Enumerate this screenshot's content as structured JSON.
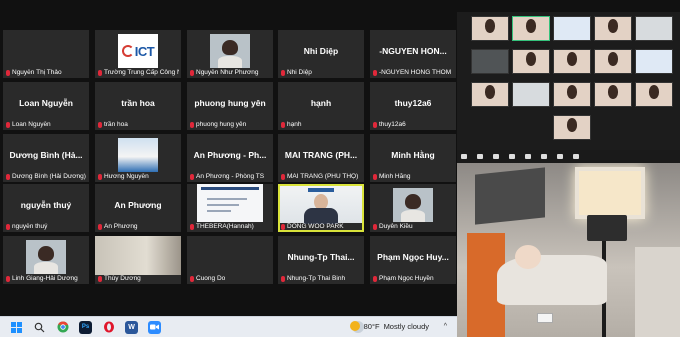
{
  "gallery": {
    "rows": [
      [
        {
          "name": "Nguyễn Thị Thảo",
          "center": "",
          "video": "none"
        },
        {
          "name": "Trường Trung Cấp Công N...",
          "center": "",
          "video": "ict"
        },
        {
          "name": "Nguyễn Như Phương",
          "center": "",
          "video": "person"
        },
        {
          "name": "Nhi Diệp",
          "center": "Nhi Diệp",
          "video": "none"
        },
        {
          "name": "-NGUYEN HONG THOM",
          "center": "-NGUYEN HON...",
          "video": "none"
        }
      ],
      [
        {
          "name": "Loan Nguyễn",
          "center": "Loan Nguyễn",
          "video": "none"
        },
        {
          "name": "trần hoa",
          "center": "trần hoa",
          "video": "none"
        },
        {
          "name": "phuong hung yên",
          "center": "phuong hung yên",
          "video": "none"
        },
        {
          "name": "hạnh",
          "center": "hạnh",
          "video": "none"
        },
        {
          "name": "thuy12a6",
          "center": "thuy12a6",
          "video": "none"
        }
      ],
      [
        {
          "name": "Dương Bình (Hải Dương)",
          "center": "Dương Bình (Hả...",
          "video": "none"
        },
        {
          "name": "Hương Nguyễn",
          "center": "",
          "video": "group"
        },
        {
          "name": "An Phương - Phòng TS",
          "center": "An Phương - Ph...",
          "video": "none"
        },
        {
          "name": "MAI TRANG (PHÚ THỌ)",
          "center": "MAI TRANG (PH...",
          "video": "none"
        },
        {
          "name": "Minh Hằng",
          "center": "Minh Hằng",
          "video": "none"
        }
      ],
      [
        {
          "name": "nguyễn thuý",
          "center": "nguyễn thuý",
          "video": "none"
        },
        {
          "name": "An Phương",
          "center": "An Phương",
          "video": "none"
        },
        {
          "name": "THEBERA(Hannah)",
          "center": "",
          "video": "slide"
        },
        {
          "name": "DONG WOO PARK",
          "center": "",
          "video": "speaker",
          "active": true
        },
        {
          "name": "Duyên Kiều",
          "center": "",
          "video": "person"
        }
      ],
      [
        {
          "name": "Linh Giang-Hải Dương",
          "center": "",
          "video": "person"
        },
        {
          "name": "Thùy Dương",
          "center": "",
          "video": "room"
        },
        {
          "name": "Cuong Do",
          "center": "",
          "video": "none"
        },
        {
          "name": "Nhung-Tp Thai Binh",
          "center": "Nhung-Tp Thai...",
          "video": "none"
        },
        {
          "name": "Phạm Ngọc Huyền",
          "center": "Phạm Ngọc Huy...",
          "video": "none"
        }
      ]
    ],
    "ict_logo": "ICT"
  },
  "taskbar": {
    "icons": [
      "windows-icon",
      "search-icon",
      "chrome-icon",
      "photoshop-icon",
      "opera-icon",
      "word-icon",
      "zoom-icon"
    ],
    "weather_temp": "80°F",
    "weather_desc": "Mostly cloudy"
  },
  "colors": {
    "tile_bg": "#2a2a2a",
    "active_outline": "#d9e33a",
    "mic_muted": "#e0283a",
    "taskbar_bg": "#e8ecf2"
  }
}
